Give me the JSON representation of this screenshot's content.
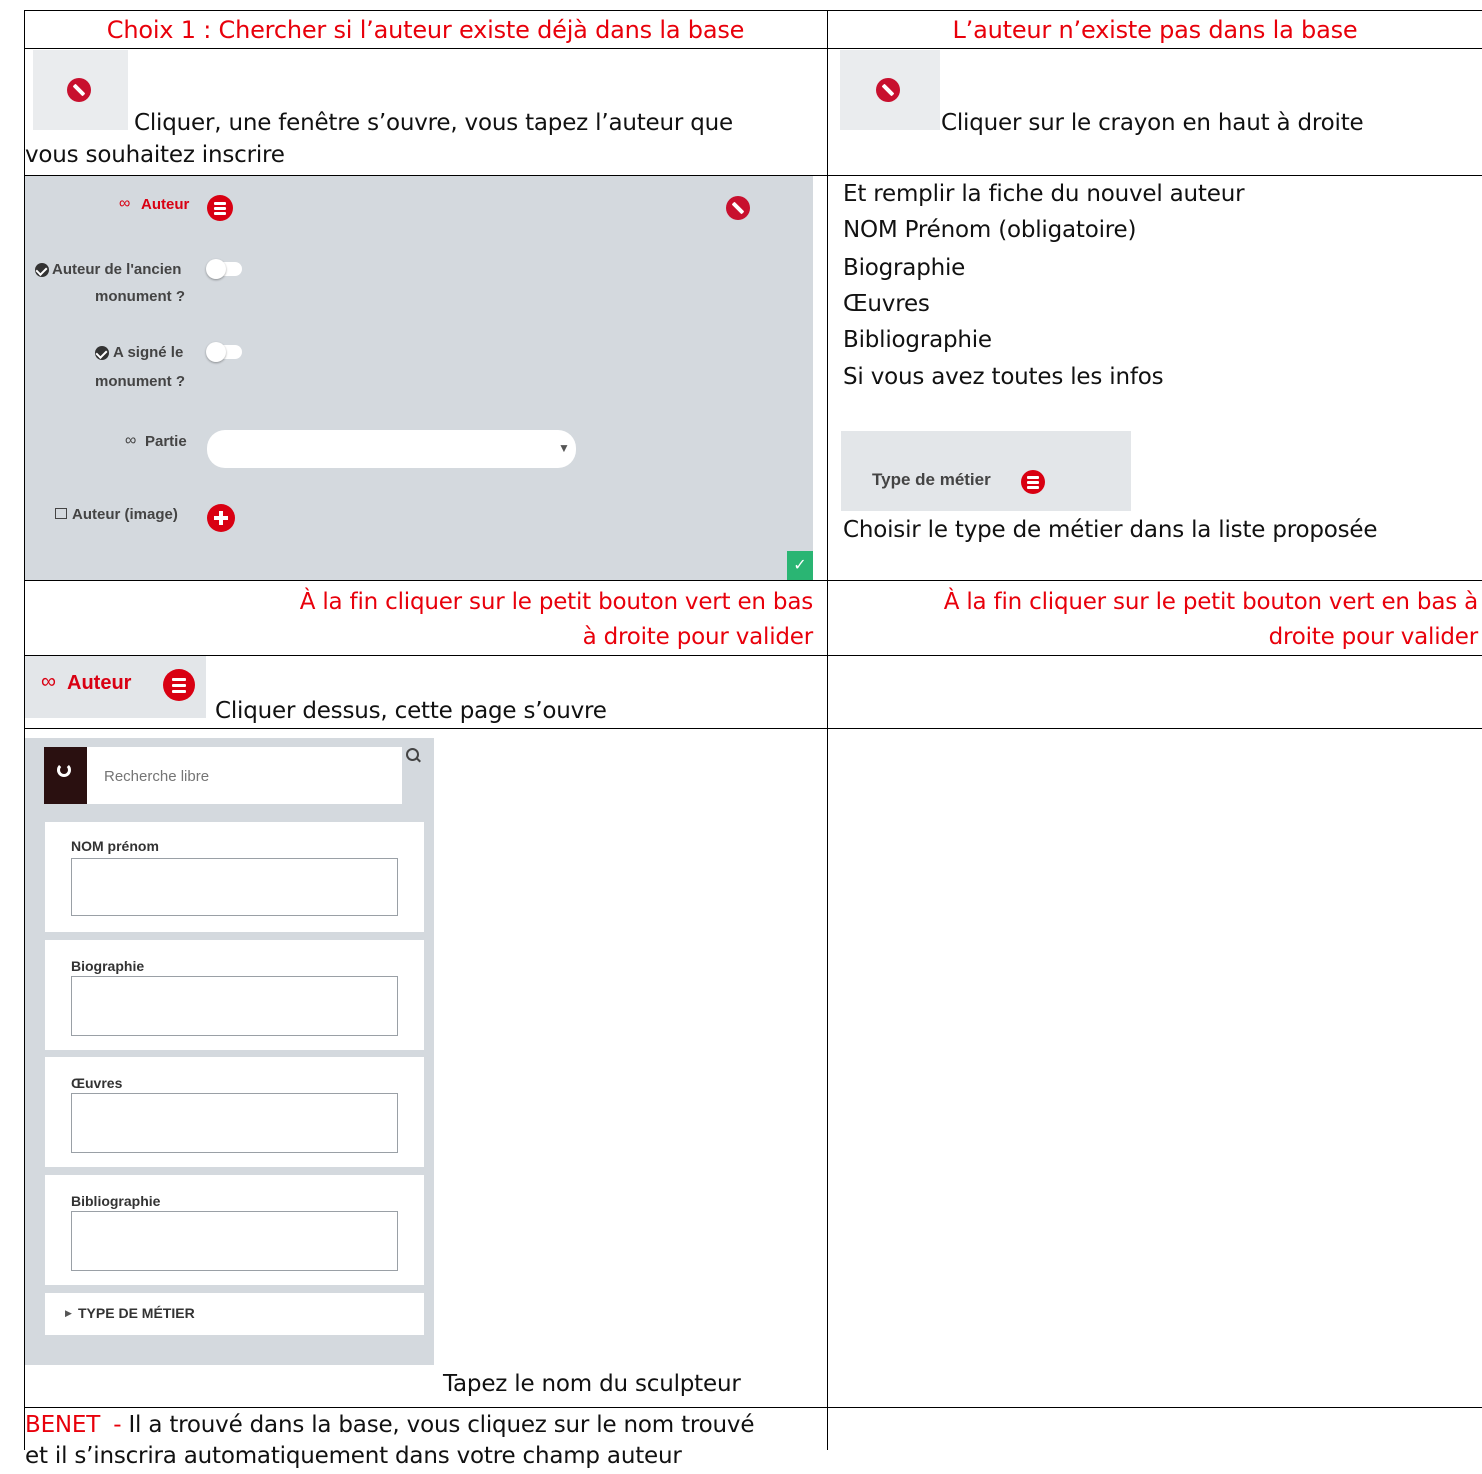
{
  "row1": {
    "left_heading": "Choix 1 : Chercher si l’auteur existe déjà dans la base",
    "right_heading": "L’auteur n’existe pas dans la base"
  },
  "row2": {
    "left_text_line1": "Cliquer, une fenêtre s’ouvre, vous tapez l’auteur que",
    "left_text_line2": "vous souhaitez inscrire",
    "right_text": "Cliquer sur le crayon en haut à droite"
  },
  "form_panel": {
    "auteur_label": "Auteur",
    "ancien_label_line1": "Auteur de l'ancien",
    "ancien_label_line2": "monument ?",
    "signe_label_line1": "A signé le",
    "signe_label_line2": "monument ?",
    "partie_label": "Partie",
    "partie_value": "",
    "image_label": "Auteur (image)",
    "check_symbol": "✓"
  },
  "row3_right": {
    "lines": [
      "Et remplir la fiche du nouvel auteur",
      "NOM Prénom (obligatoire)",
      "Biographie",
      "Œuvres",
      "Bibliographie",
      "Si vous avez toutes les infos"
    ],
    "type_metier_label": "Type de métier",
    "after_text": "Choisir le type de métier dans la liste proposée"
  },
  "row4": {
    "left_line1": "À la fin cliquer sur le petit bouton vert en bas",
    "left_line2": "à droite pour valider",
    "right_line1": "À la fin cliquer sur le petit bouton vert en bas à",
    "right_line2": "droite pour valider"
  },
  "row5": {
    "auteur_label": "Auteur",
    "text": "Cliquer dessus, cette page s’ouvre"
  },
  "search_panel": {
    "search_placeholder": "Recherche libre",
    "fields": [
      "NOM prénom",
      "Biographie",
      "Œuvres",
      "Bibliographie"
    ],
    "type_metier": "TYPE DE MÉTIER",
    "after_text": "Tapez le nom du sculpteur"
  },
  "row7": {
    "name": "BENET",
    "dash": "-",
    "line1_rest": "Il a trouvé dans la base, vous cliquez sur le nom trouvé",
    "line2": "et il s’inscrira automatiquement dans votre champ auteur"
  }
}
